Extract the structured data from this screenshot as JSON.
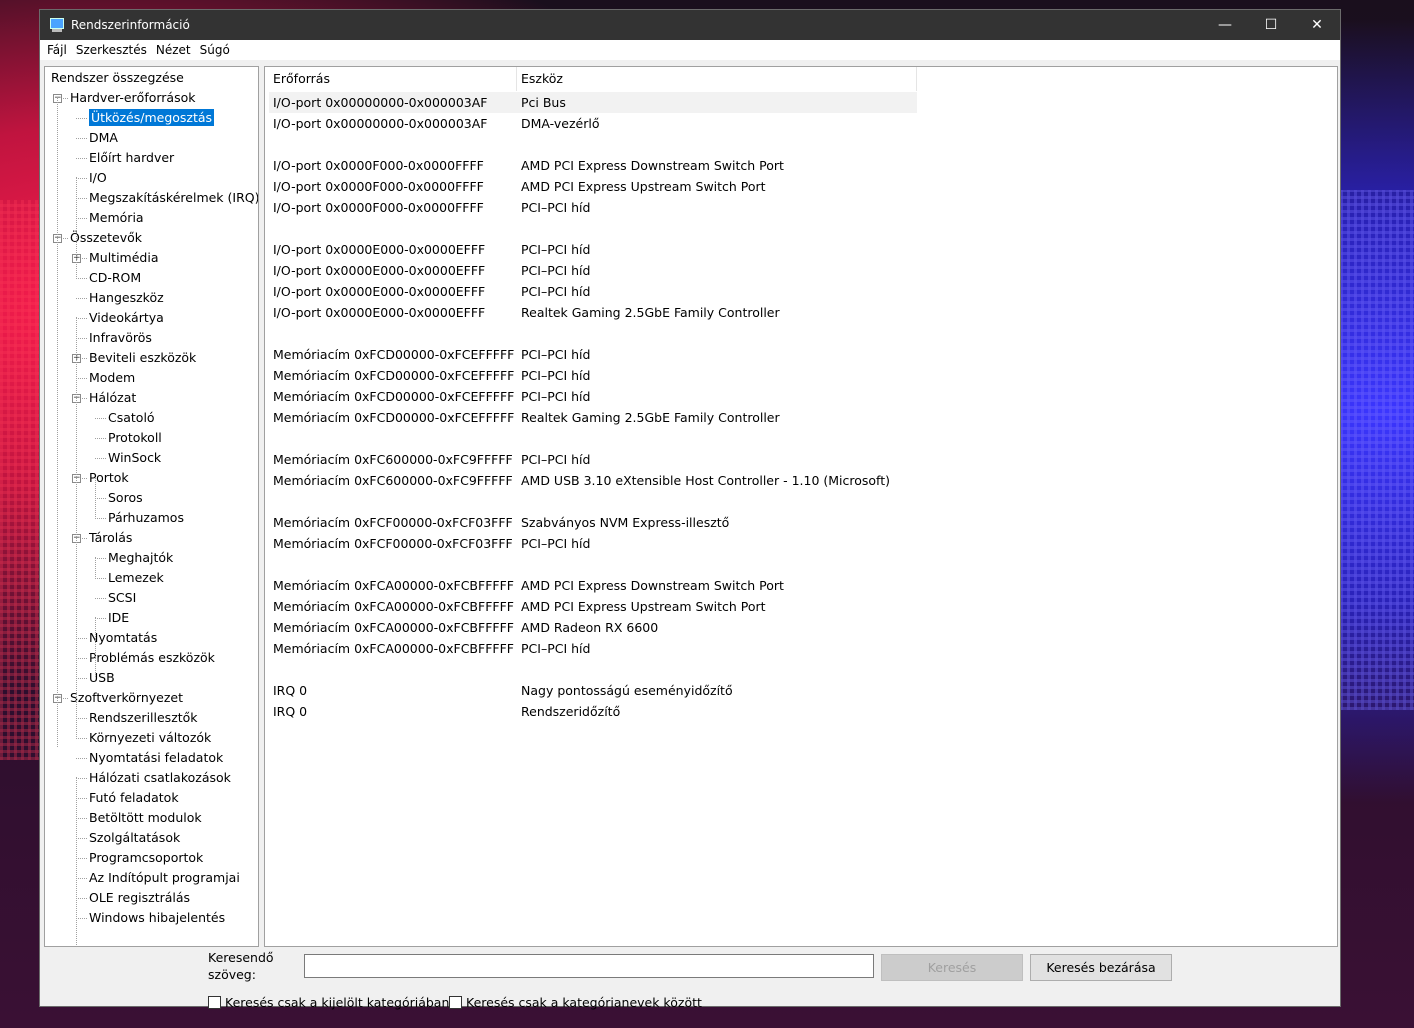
{
  "window": {
    "title": "Rendszerinformáció",
    "minimize": "—",
    "maximize": "☐",
    "close": "✕"
  },
  "menu": [
    "Fájl",
    "Szerkesztés",
    "Nézet",
    "Súgó"
  ],
  "tree": [
    {
      "label": "Rendszer összegzése",
      "level": 0,
      "expander": ""
    },
    {
      "label": "Hardver-erőforrások",
      "level": 1,
      "expander": "−"
    },
    {
      "label": "Ütközés/megosztás",
      "level": 2,
      "expander": "",
      "selected": true
    },
    {
      "label": "DMA",
      "level": 2,
      "expander": ""
    },
    {
      "label": "Előírt hardver",
      "level": 2,
      "expander": ""
    },
    {
      "label": "I/O",
      "level": 2,
      "expander": ""
    },
    {
      "label": "Megszakításkérelmek (IRQ)",
      "level": 2,
      "expander": ""
    },
    {
      "label": "Memória",
      "level": 2,
      "expander": ""
    },
    {
      "label": "Összetevők",
      "level": 1,
      "expander": "−"
    },
    {
      "label": "Multimédia",
      "level": 2,
      "expander": "+"
    },
    {
      "label": "CD-ROM",
      "level": 2,
      "expander": ""
    },
    {
      "label": "Hangeszköz",
      "level": 2,
      "expander": ""
    },
    {
      "label": "Videokártya",
      "level": 2,
      "expander": ""
    },
    {
      "label": "Infravörös",
      "level": 2,
      "expander": ""
    },
    {
      "label": "Beviteli eszközök",
      "level": 2,
      "expander": "+"
    },
    {
      "label": "Modem",
      "level": 2,
      "expander": ""
    },
    {
      "label": "Hálózat",
      "level": 2,
      "expander": "−"
    },
    {
      "label": "Csatoló",
      "level": 3,
      "expander": ""
    },
    {
      "label": "Protokoll",
      "level": 3,
      "expander": ""
    },
    {
      "label": "WinSock",
      "level": 3,
      "expander": ""
    },
    {
      "label": "Portok",
      "level": 2,
      "expander": "−"
    },
    {
      "label": "Soros",
      "level": 3,
      "expander": ""
    },
    {
      "label": "Párhuzamos",
      "level": 3,
      "expander": ""
    },
    {
      "label": "Tárolás",
      "level": 2,
      "expander": "−"
    },
    {
      "label": "Meghajtók",
      "level": 3,
      "expander": ""
    },
    {
      "label": "Lemezek",
      "level": 3,
      "expander": ""
    },
    {
      "label": "SCSI",
      "level": 3,
      "expander": ""
    },
    {
      "label": "IDE",
      "level": 3,
      "expander": ""
    },
    {
      "label": "Nyomtatás",
      "level": 2,
      "expander": ""
    },
    {
      "label": "Problémás eszközök",
      "level": 2,
      "expander": ""
    },
    {
      "label": "USB",
      "level": 2,
      "expander": ""
    },
    {
      "label": "Szoftverkörnyezet",
      "level": 1,
      "expander": "−"
    },
    {
      "label": "Rendszerillesztők",
      "level": 2,
      "expander": ""
    },
    {
      "label": "Környezeti változók",
      "level": 2,
      "expander": ""
    },
    {
      "label": "Nyomtatási feladatok",
      "level": 2,
      "expander": ""
    },
    {
      "label": "Hálózati csatlakozások",
      "level": 2,
      "expander": ""
    },
    {
      "label": "Futó feladatok",
      "level": 2,
      "expander": ""
    },
    {
      "label": "Betöltött modulok",
      "level": 2,
      "expander": ""
    },
    {
      "label": "Szolgáltatások",
      "level": 2,
      "expander": ""
    },
    {
      "label": "Programcsoportok",
      "level": 2,
      "expander": ""
    },
    {
      "label": "Az Indítópult programjai",
      "level": 2,
      "expander": ""
    },
    {
      "label": "OLE regisztrálás",
      "level": 2,
      "expander": ""
    },
    {
      "label": "Windows hibajelentés",
      "level": 2,
      "expander": ""
    }
  ],
  "table": {
    "columns": [
      "Erőforrás",
      "Eszköz"
    ],
    "rows": [
      [
        "I/O-port 0x00000000-0x000003AF",
        "Pci Bus"
      ],
      [
        "I/O-port 0x00000000-0x000003AF",
        "DMA-vezérlő"
      ],
      [
        "",
        ""
      ],
      [
        "I/O-port 0x0000F000-0x0000FFFF",
        "AMD PCI Express Downstream Switch Port"
      ],
      [
        "I/O-port 0x0000F000-0x0000FFFF",
        "AMD PCI Express Upstream Switch Port"
      ],
      [
        "I/O-port 0x0000F000-0x0000FFFF",
        "PCI–PCI híd"
      ],
      [
        "",
        ""
      ],
      [
        "I/O-port 0x0000E000-0x0000EFFF",
        "PCI–PCI híd"
      ],
      [
        "I/O-port 0x0000E000-0x0000EFFF",
        "PCI–PCI híd"
      ],
      [
        "I/O-port 0x0000E000-0x0000EFFF",
        "PCI–PCI híd"
      ],
      [
        "I/O-port 0x0000E000-0x0000EFFF",
        "Realtek Gaming 2.5GbE Family Controller"
      ],
      [
        "",
        ""
      ],
      [
        "Memóriacím 0xFCD00000-0xFCEFFFFF",
        "PCI–PCI híd"
      ],
      [
        "Memóriacím 0xFCD00000-0xFCEFFFFF",
        "PCI–PCI híd"
      ],
      [
        "Memóriacím 0xFCD00000-0xFCEFFFFF",
        "PCI–PCI híd"
      ],
      [
        "Memóriacím 0xFCD00000-0xFCEFFFFF",
        "Realtek Gaming 2.5GbE Family Controller"
      ],
      [
        "",
        ""
      ],
      [
        "Memóriacím 0xFC600000-0xFC9FFFFF",
        "PCI–PCI híd"
      ],
      [
        "Memóriacím 0xFC600000-0xFC9FFFFF",
        "AMD USB 3.10 eXtensible Host Controller - 1.10 (Microsoft)"
      ],
      [
        "",
        ""
      ],
      [
        "Memóriacím 0xFCF00000-0xFCF03FFF",
        "Szabványos NVM Express-illesztő"
      ],
      [
        "Memóriacím 0xFCF00000-0xFCF03FFF",
        "PCI–PCI híd"
      ],
      [
        "",
        ""
      ],
      [
        "Memóriacím 0xFCA00000-0xFCBFFFFF",
        "AMD PCI Express Downstream Switch Port"
      ],
      [
        "Memóriacím 0xFCA00000-0xFCBFFFFF",
        "AMD PCI Express Upstream Switch Port"
      ],
      [
        "Memóriacím 0xFCA00000-0xFCBFFFFF",
        "AMD Radeon RX 6600"
      ],
      [
        "Memóriacím 0xFCA00000-0xFCBFFFFF",
        "PCI–PCI híd"
      ],
      [
        "",
        ""
      ],
      [
        "IRQ 0",
        "Nagy pontosságú eseményidőzítő"
      ],
      [
        "IRQ 0",
        "Rendszeridőzítő"
      ]
    ]
  },
  "search": {
    "label": "Keresendő szöveg:",
    "value": "",
    "search_button": "Keresés",
    "close_button": "Keresés bezárása",
    "check1": "Keresés csak a kijelölt kategóriában",
    "check2": "Keresés csak a kategórianevek között"
  }
}
